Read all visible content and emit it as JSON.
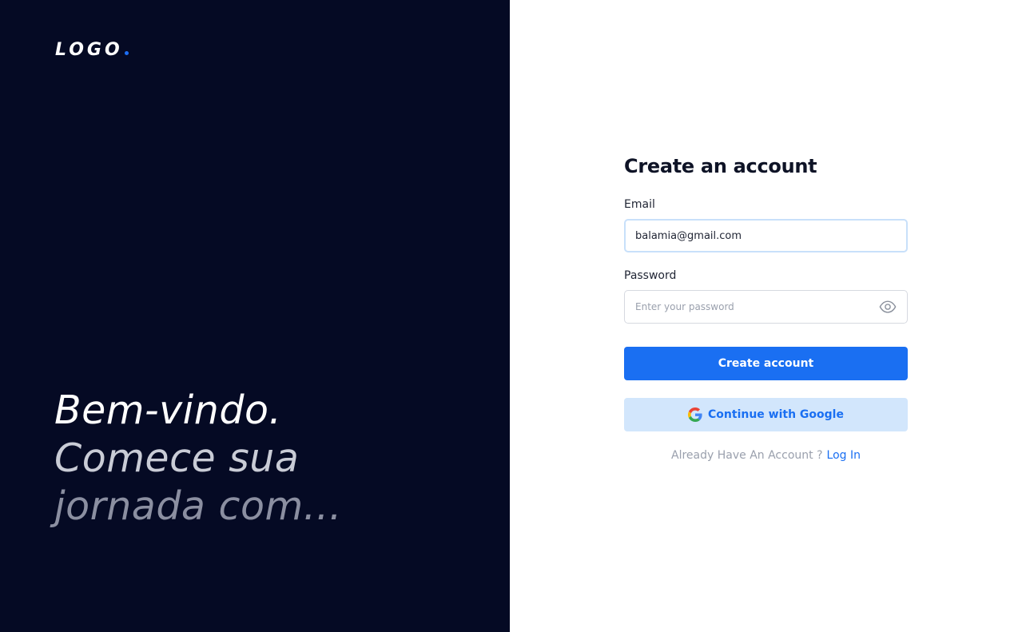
{
  "brand": {
    "logo_text": "LOGO",
    "accent_color": "#1d6ef5",
    "left_bg_color": "#050a24"
  },
  "hero": {
    "lines": [
      "Bem-vindo.",
      "Comece sua",
      "jornada com..."
    ]
  },
  "form": {
    "title": "Create an account",
    "email": {
      "label": "Email",
      "value": "balamia@gmail.com",
      "placeholder": ""
    },
    "password": {
      "label": "Password",
      "value": "",
      "placeholder": "Enter your password",
      "toggle_icon": "eye-icon"
    },
    "create_button_label": "Create account",
    "google_button": {
      "label": "Continue with Google",
      "icon": "google-icon"
    },
    "footer": {
      "prompt": "Already Have An Account ?",
      "link_label": "Log In"
    }
  }
}
